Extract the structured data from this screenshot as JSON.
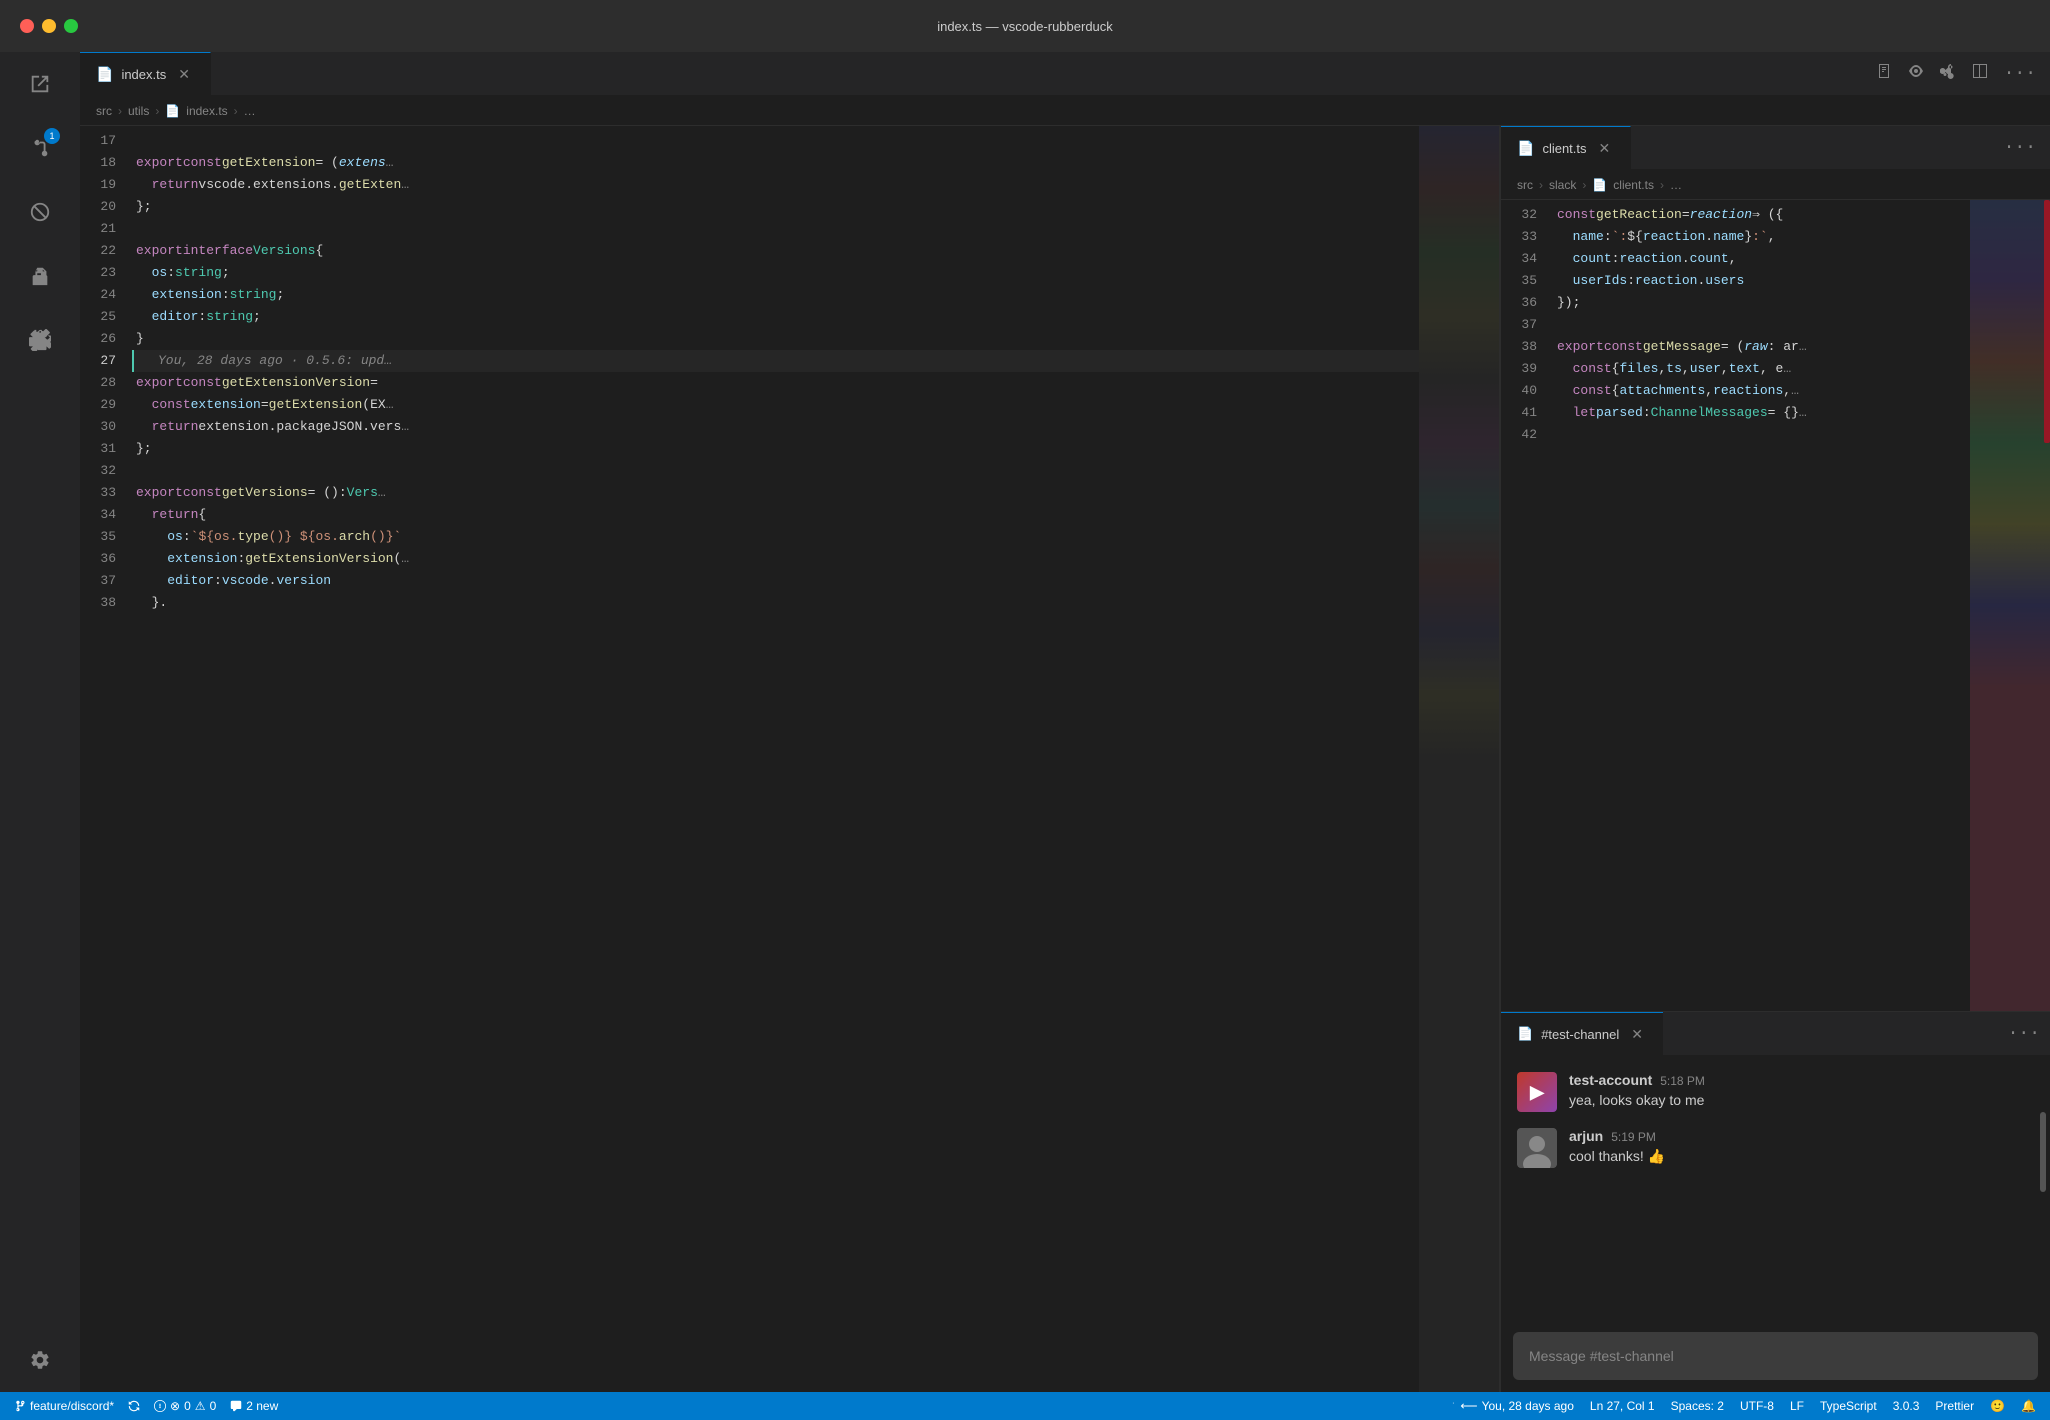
{
  "titlebar": {
    "title": "index.ts — vscode-rubberduck"
  },
  "tabs_left": {
    "tab1": {
      "label": "index.ts",
      "active": true,
      "has_close": true
    }
  },
  "tabs_right_top": {
    "tab1": {
      "label": "client.ts",
      "active": true,
      "has_close": true
    }
  },
  "breadcrumb_left": {
    "items": [
      "src",
      "utils",
      "index.ts",
      "…"
    ]
  },
  "breadcrumb_right": {
    "items": [
      "src",
      "slack",
      "client.ts",
      "…"
    ]
  },
  "left_code": {
    "lines": [
      {
        "num": "17",
        "content": ""
      },
      {
        "num": "18",
        "content": "export const getExtension = (extens…"
      },
      {
        "num": "19",
        "content": "  return vscode.extensions.getExten…"
      },
      {
        "num": "20",
        "content": "};"
      },
      {
        "num": "21",
        "content": ""
      },
      {
        "num": "22",
        "content": "export interface Versions {"
      },
      {
        "num": "23",
        "content": "  os: string;"
      },
      {
        "num": "24",
        "content": "  extension: string;"
      },
      {
        "num": "25",
        "content": "  editor: string;"
      },
      {
        "num": "26",
        "content": "}"
      },
      {
        "num": "27",
        "content": ""
      },
      {
        "num": "28",
        "content": "export const getExtensionVersion ="
      },
      {
        "num": "29",
        "content": "  const extension = getExtension(EX…"
      },
      {
        "num": "30",
        "content": "  return extension.packageJSON.vers…"
      },
      {
        "num": "31",
        "content": "};"
      },
      {
        "num": "32",
        "content": ""
      },
      {
        "num": "33",
        "content": "export const getVersions = (): Vers…"
      },
      {
        "num": "34",
        "content": "  return {"
      },
      {
        "num": "35",
        "content": "    os: `${os.type()} ${os.arch()}`"
      },
      {
        "num": "36",
        "content": "    extension: getExtensionVersion(…"
      },
      {
        "num": "37",
        "content": "    editor: vscode.version"
      },
      {
        "num": "38",
        "content": "  }."
      }
    ],
    "blame": "You, 28 days ago · 0.5.6: upd…",
    "active_line": "27"
  },
  "right_code": {
    "lines": [
      {
        "num": "32",
        "content": "const getReaction = reaction => ({"
      },
      {
        "num": "33",
        "content": "  name: `:${reaction.name}:`,"
      },
      {
        "num": "34",
        "content": "  count: reaction.count,"
      },
      {
        "num": "35",
        "content": "  userIds: reaction.users"
      },
      {
        "num": "36",
        "content": "});"
      },
      {
        "num": "37",
        "content": ""
      },
      {
        "num": "38",
        "content": "export const getMessage = (raw: ar…"
      },
      {
        "num": "39",
        "content": "  const { files, ts, user, text, e…"
      },
      {
        "num": "40",
        "content": "  const { attachments, reactions,…"
      },
      {
        "num": "41",
        "content": "  let parsed: ChannelMessages = {}…"
      },
      {
        "num": "42",
        "content": ""
      }
    ]
  },
  "slack": {
    "channel": "#test-channel",
    "messages": [
      {
        "author": "test-account",
        "time": "5:18 PM",
        "text": "yea, looks okay to me",
        "avatar_type": "test"
      },
      {
        "author": "arjun",
        "time": "5:19 PM",
        "text": "cool thanks! 👍",
        "avatar_type": "arjun"
      }
    ],
    "input_placeholder": "Message #test-channel"
  },
  "status_bar": {
    "branch": "feature/discord*",
    "sync": "",
    "errors": "0",
    "warnings": "0",
    "new_comments": "2 new",
    "git_author": "You, 28 days ago",
    "cursor": "Ln 27, Col 1",
    "spaces": "Spaces: 2",
    "encoding": "UTF-8",
    "line_ending": "LF",
    "language": "TypeScript",
    "version": "3.0.3",
    "formatter": "Prettier"
  },
  "activity_icons": {
    "explorer": "🗋",
    "source_control": "⎇",
    "no_icon": "🚫",
    "extensions": "⊞",
    "puzzle": "🧩",
    "settings": "⚙"
  }
}
